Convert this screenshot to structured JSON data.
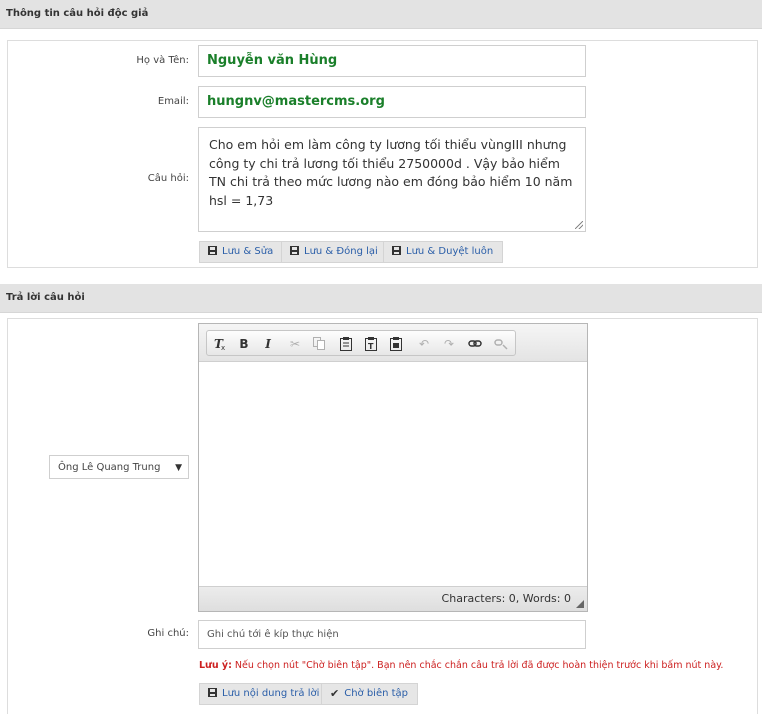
{
  "reader_section": {
    "title": "Thông tin câu hỏi độc giả",
    "name_label": "Họ và Tên:",
    "name_value": "Nguyễn văn Hùng",
    "email_label": "Email:",
    "email_value": "hungnv@mastercms.org",
    "question_label": "Câu hỏi:",
    "question_value": "Cho em hỏi em làm công ty lương tối thiểu vùngIII nhưng công ty chi trả lương tối thiểu 2750000d . Vậy bảo hiểm TN chi trả theo mức lương nào em đóng bảo hiểm 10 năm hsl = 1,73",
    "buttons": {
      "save_edit": "Lưu & Sửa",
      "save_close": "Lưu & Đóng lại",
      "save_approve": "Lưu & Duyệt luôn"
    }
  },
  "answer_section": {
    "title": "Trả lời câu hỏi",
    "expert_selected": "Ông Lê Quang Trung",
    "editor": {
      "toolbar_icons": [
        "remove-format-icon",
        "bold-icon",
        "italic-icon",
        "cut-icon",
        "copy-icon",
        "paste-icon",
        "paste-text-icon",
        "paste-word-icon",
        "undo-icon",
        "redo-icon",
        "link-icon",
        "unlink-icon"
      ],
      "word_count": "Characters: 0, Words: 0"
    },
    "note_label": "Ghi chú:",
    "note_placeholder": "Ghi chú tới ê kíp thực hiện",
    "warning_prefix": "Lưu ý:",
    "warning_text": " Nếu chọn nút \"Chờ biên tập\". Bạn nên chắc chắn câu trả lời đã được hoàn thiện trước khi bấm nút này.",
    "buttons": {
      "save_answer": "Lưu nội dung trả lời",
      "wait_edit": "Chờ biên tập"
    }
  },
  "colors": {
    "header_bg": "#e3e3e3",
    "input_text_green": "#1a7f2a",
    "button_text_blue": "#2a5ea8",
    "warning_red": "#cc1f1f"
  }
}
